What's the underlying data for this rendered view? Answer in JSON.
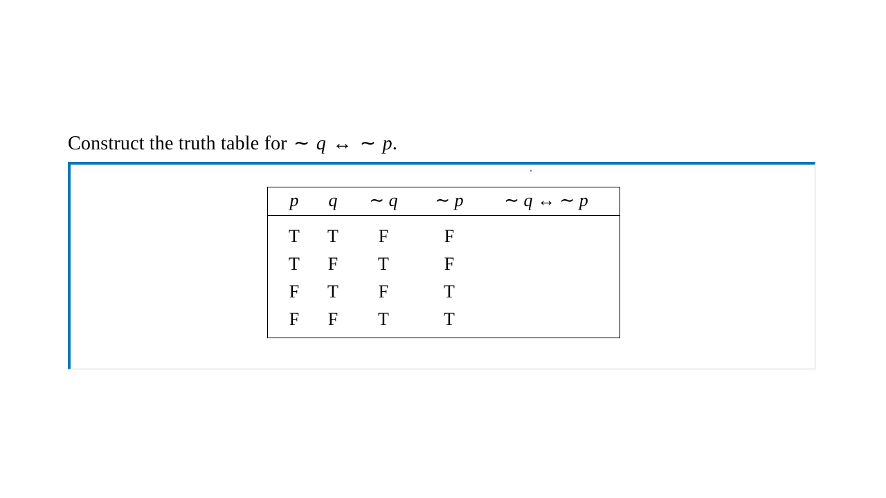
{
  "prompt": {
    "prefix": "Construct the truth table for ",
    "expr_html": "∼ <span class='math'>q</span> <span class='sym'>↔</span> ∼ <span class='math'>p</span>.",
    "expr_plain": "∼ q ↔ ∼ p"
  },
  "table": {
    "headers": {
      "p": "p",
      "q": "q",
      "not_q": "∼ q",
      "not_p": "∼ p",
      "bicond": "∼ q ↔ ∼ p"
    },
    "rows": [
      {
        "p": "T",
        "q": "T",
        "not_q": "F",
        "not_p": "F",
        "bicond": ""
      },
      {
        "p": "T",
        "q": "F",
        "not_q": "T",
        "not_p": "F",
        "bicond": ""
      },
      {
        "p": "F",
        "q": "T",
        "not_q": "F",
        "not_p": "T",
        "bicond": ""
      },
      {
        "p": "F",
        "q": "F",
        "not_q": "T",
        "not_p": "T",
        "bicond": ""
      }
    ]
  },
  "colors": {
    "accent": "#0178b7"
  }
}
